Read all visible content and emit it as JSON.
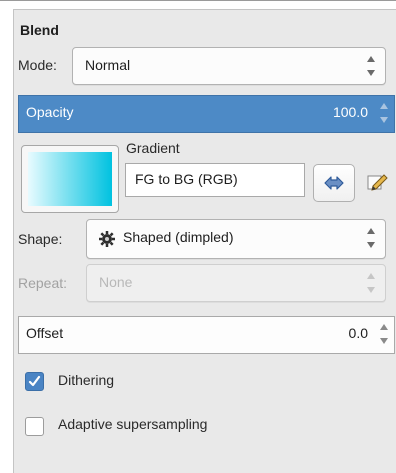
{
  "blend": {
    "title": "Blend",
    "mode": {
      "label": "Mode:",
      "value": "Normal"
    },
    "opacity": {
      "label": "Opacity",
      "value": "100.0"
    },
    "gradient": {
      "label": "Gradient",
      "value": "FG to BG (RGB)",
      "preview_colors": [
        "#e8fbff",
        "#00c2e0"
      ],
      "reverse_icon": "swap-arrows-icon",
      "edit_icon": "pencil-icon"
    },
    "shape": {
      "label": "Shape:",
      "value": "Shaped (dimpled)",
      "icon": "gear-icon"
    },
    "repeat": {
      "label": "Repeat:",
      "value": "None",
      "enabled": false
    },
    "offset": {
      "label": "Offset",
      "value": "0.0"
    },
    "dithering": {
      "label": "Dithering",
      "checked": true
    },
    "adaptive": {
      "label": "Adaptive supersampling",
      "checked": false
    }
  },
  "colors": {
    "accent": "#4d8ac6",
    "panel": "#e9e9e9"
  }
}
